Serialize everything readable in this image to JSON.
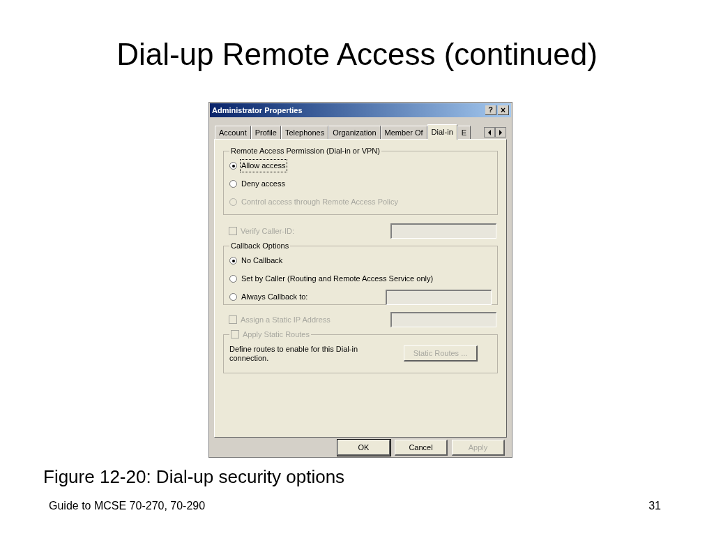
{
  "slide": {
    "title": "Dial-up Remote Access (continued)",
    "caption": "Figure 12-20: Dial-up security options",
    "footer": "Guide to MCSE 70-270, 70-290",
    "page_number": "31"
  },
  "dialog": {
    "title": "Administrator Properties",
    "help_button": "?",
    "close_button": "×",
    "tabs": [
      {
        "label": "Account",
        "selected": false
      },
      {
        "label": "Profile",
        "selected": false
      },
      {
        "label": "Telephones",
        "selected": false
      },
      {
        "label": "Organization",
        "selected": false
      },
      {
        "label": "Member Of",
        "selected": false
      },
      {
        "label": "Dial-in",
        "selected": true
      },
      {
        "label": "E",
        "selected": false
      }
    ],
    "permission_group": {
      "legend": "Remote Access Permission (Dial-in or VPN)",
      "options": [
        {
          "label": "Allow access",
          "selected": true,
          "disabled": false,
          "focused": true
        },
        {
          "label": "Deny access",
          "selected": false,
          "disabled": false,
          "focused": false
        },
        {
          "label": "Control access through Remote Access Policy",
          "selected": false,
          "disabled": true,
          "focused": false
        }
      ]
    },
    "verify_caller_id": {
      "label": "Verify Caller-ID:",
      "checked": false,
      "disabled": true,
      "field": {
        "disabled": true
      }
    },
    "callback_group": {
      "legend": "Callback Options",
      "options": [
        {
          "label": "No Callback",
          "selected": true,
          "disabled": false
        },
        {
          "label": "Set by Caller (Routing and Remote Access Service only)",
          "selected": false,
          "disabled": false
        },
        {
          "label": "Always Callback to:",
          "selected": false,
          "disabled": false,
          "field": {
            "disabled": true
          }
        }
      ]
    },
    "static_ip": {
      "label": "Assign a Static IP Address",
      "checked": false,
      "disabled": true,
      "field": {
        "disabled": true
      }
    },
    "static_routes": {
      "label": "Apply Static Routes",
      "checked": false,
      "disabled": true,
      "description": "Define routes to enable for this Dial-in connection.",
      "button": {
        "label": "Static Routes ...",
        "disabled": true
      }
    },
    "buttons": [
      {
        "label": "OK",
        "default": true,
        "disabled": false
      },
      {
        "label": "Cancel",
        "default": false,
        "disabled": false
      },
      {
        "label": "Apply",
        "default": false,
        "disabled": true
      }
    ]
  }
}
